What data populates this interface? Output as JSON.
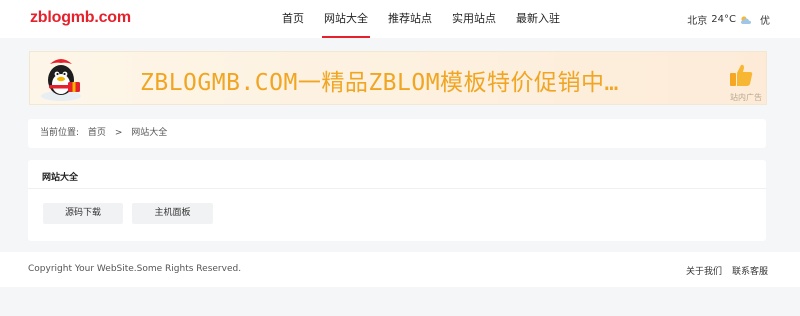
{
  "header": {
    "logo": "zblogmb.com",
    "nav": [
      {
        "label": "首页"
      },
      {
        "label": "网站大全",
        "active": true
      },
      {
        "label": "推荐站点"
      },
      {
        "label": "实用站点"
      },
      {
        "label": "最新入驻"
      }
    ],
    "weather": {
      "city": "北京",
      "temp": "24°C",
      "icon": "cloudy-icon",
      "quality": "优"
    }
  },
  "banner": {
    "text": "ZBLOGMB.COM一精品ZBLOM模板特价促销中…",
    "ad_label": "站内广告",
    "text_color": "#f0a623"
  },
  "breadcrumb": {
    "prefix": "当前位置:",
    "items": [
      "首页",
      ">",
      "网站大全"
    ]
  },
  "panel": {
    "title": "网站大全",
    "tags": [
      "源码下载",
      "主机面板"
    ]
  },
  "footer": {
    "copyright": "Copyright Your WebSite.Some Rights Reserved.",
    "links": [
      "关于我们",
      "联系客服"
    ]
  },
  "colors": {
    "accent": "#e5212d",
    "background": "#f5f6f8"
  }
}
